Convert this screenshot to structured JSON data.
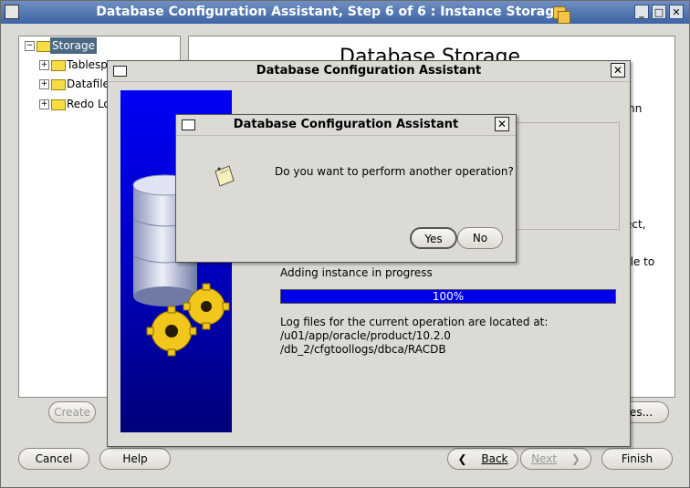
{
  "window": {
    "title": "Database Configuration Assistant, Step 6 of 6 : Instance Storage",
    "controls": [
      "minimize",
      "maximize",
      "close"
    ]
  },
  "tree": {
    "root": "Storage",
    "items": [
      "Tablesp",
      "Datafile",
      "Redo Lo"
    ]
  },
  "right_panel": {
    "title": "Database Storage",
    "fragments": [
      "mn",
      "ect,",
      "ble to"
    ]
  },
  "bottom_buttons": {
    "create": "Create",
    "tables": "bles...",
    "cancel": "Cancel",
    "help": "Help",
    "back": "Back",
    "next": "Next",
    "finish": "Finish"
  },
  "progress_dialog": {
    "title": "Database Configuration Assistant",
    "status": "Adding instance in progress",
    "progress_text": "100%",
    "progress_value": 1.0,
    "log_label": "Log files for the current operation are located at:",
    "log_path_1": "/u01/app/oracle/product/10.2.0",
    "log_path_2": "/db_2/cfgtoollogs/dbca/RACDB"
  },
  "confirm_dialog": {
    "title": "Database Configuration Assistant",
    "message": "Do you want to perform another operation?",
    "yes": "Yes",
    "no": "No"
  },
  "colors": {
    "titlebar": "#3d64a5",
    "progress": "#0000e8",
    "banner": "#0000c8"
  }
}
